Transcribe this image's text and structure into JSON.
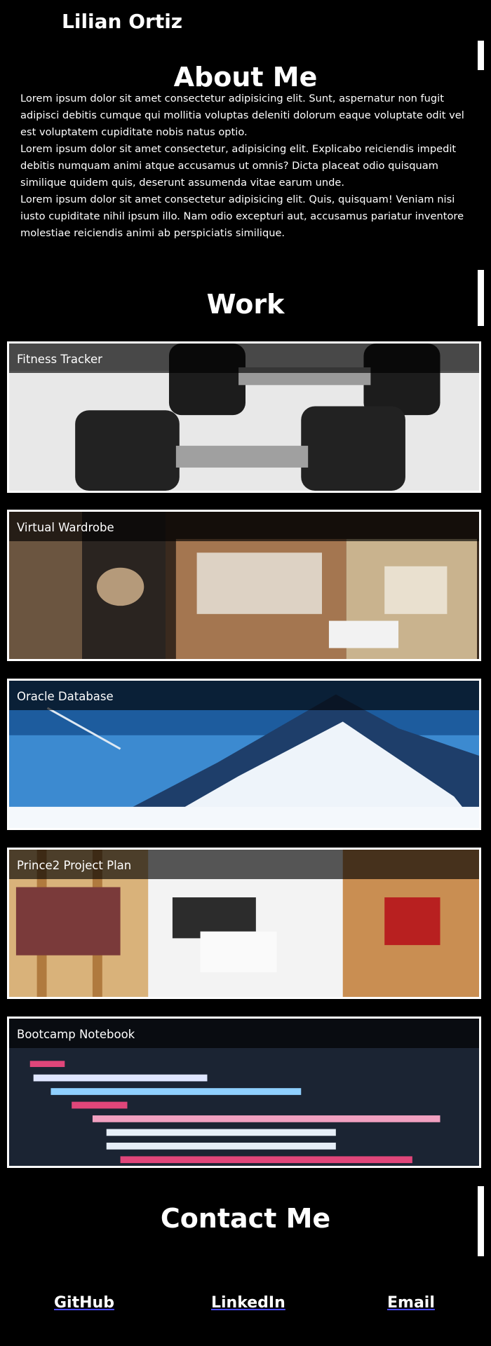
{
  "header": {
    "name": "Lilian Ortiz"
  },
  "about": {
    "title": "About Me",
    "paragraphs": [
      "Lorem ipsum dolor sit amet consectetur adipisicing elit. Sunt, aspernatur non fugit adipisci debitis cumque qui mollitia voluptas deleniti dolorum eaque voluptate odit vel est voluptatem cupiditate nobis natus optio.",
      "Lorem ipsum dolor sit amet consectetur, adipisicing elit. Explicabo reiciendis impedit debitis numquam animi atque accusamus ut omnis? Dicta placeat odio quisquam similique quidem quis, deserunt assumenda vitae earum unde.",
      "Lorem ipsum dolor sit amet consectetur adipisicing elit. Quis, quisquam! Veniam nisi iusto cupiditate nihil ipsum illo. Nam odio excepturi aut, accusamus pariatur inventore molestiae reiciendis animi ab perspiciatis similique."
    ]
  },
  "work": {
    "title": "Work",
    "projects": [
      {
        "label": "Fitness Tracker"
      },
      {
        "label": "Virtual Wardrobe"
      },
      {
        "label": "Oracle Database"
      },
      {
        "label": "Prince2 Project Plan"
      },
      {
        "label": "Bootcamp Notebook"
      }
    ]
  },
  "contact": {
    "title": "Contact Me",
    "links": [
      "GitHub",
      "LinkedIn",
      "Email"
    ]
  }
}
